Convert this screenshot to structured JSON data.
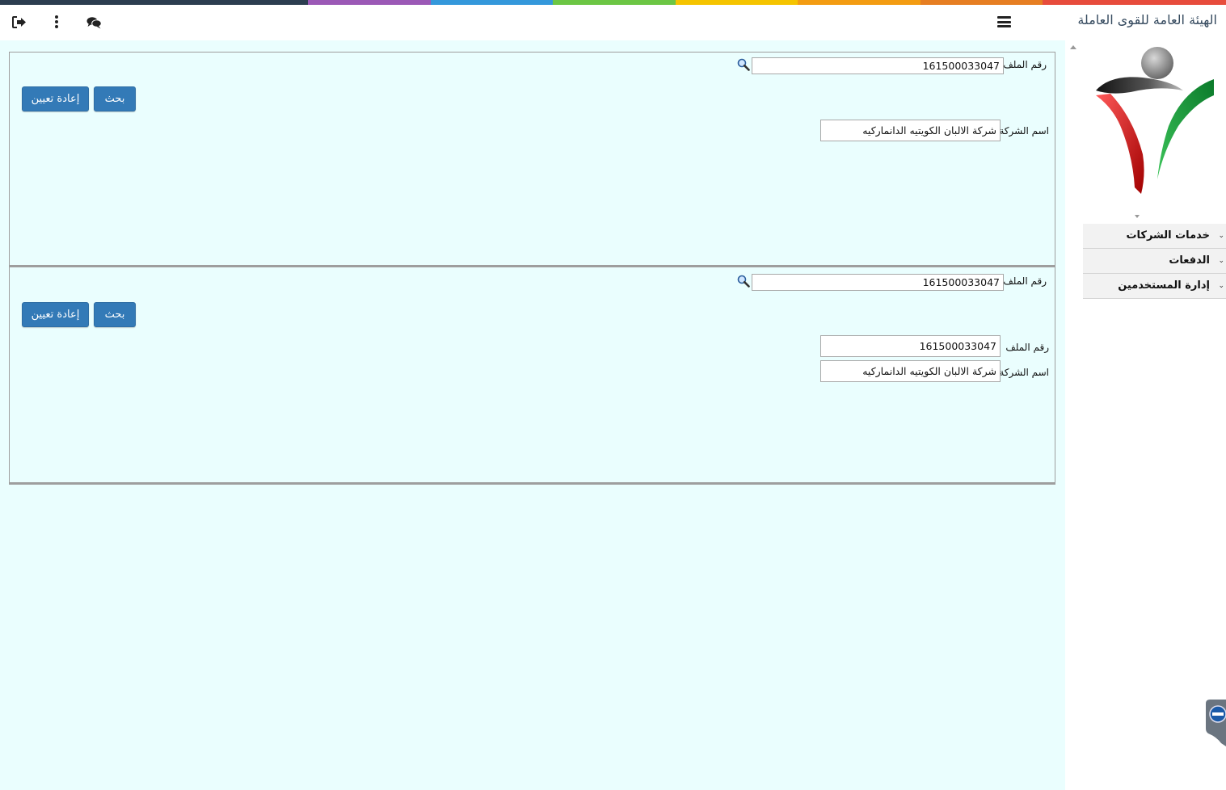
{
  "header": {
    "org_title": "الهيئة العامة للقوى العاملة",
    "icons": [
      "logout-icon",
      "more-vertical-icon",
      "chat-icon",
      "hamburger-menu-icon"
    ]
  },
  "colors": {
    "strip": [
      "#2c3e50",
      "#9b59b6",
      "#3498db",
      "#6cc644",
      "#f5c400",
      "#f39c12",
      "#e67e22",
      "#e74c3c"
    ],
    "button": "#337ab7",
    "main_bg": "#eafefe"
  },
  "sidebar": {
    "menu": [
      {
        "label": "خدمات الشركات"
      },
      {
        "label": "الدفعات"
      },
      {
        "label": "إدارة المستخدمين"
      }
    ]
  },
  "panel1": {
    "file_no_label": "رقم الملف",
    "file_no_value": "161500033047",
    "search_label": "بحث",
    "reset_label": "إعادة تعيين",
    "company_label": "اسم الشركة",
    "company_value": "شركة الالبان الكويتيه الدانماركيه"
  },
  "panel2": {
    "file_no_label": "رقم الملف",
    "file_no_value": "161500033047",
    "search_label": "بحث",
    "reset_label": "إعادة تعيين",
    "result_file_label": "رقم الملف",
    "result_file_value": "161500033047",
    "company_label": "اسم الشركة",
    "company_value": "شركة الالبان الكويتيه الدانماركيه"
  }
}
